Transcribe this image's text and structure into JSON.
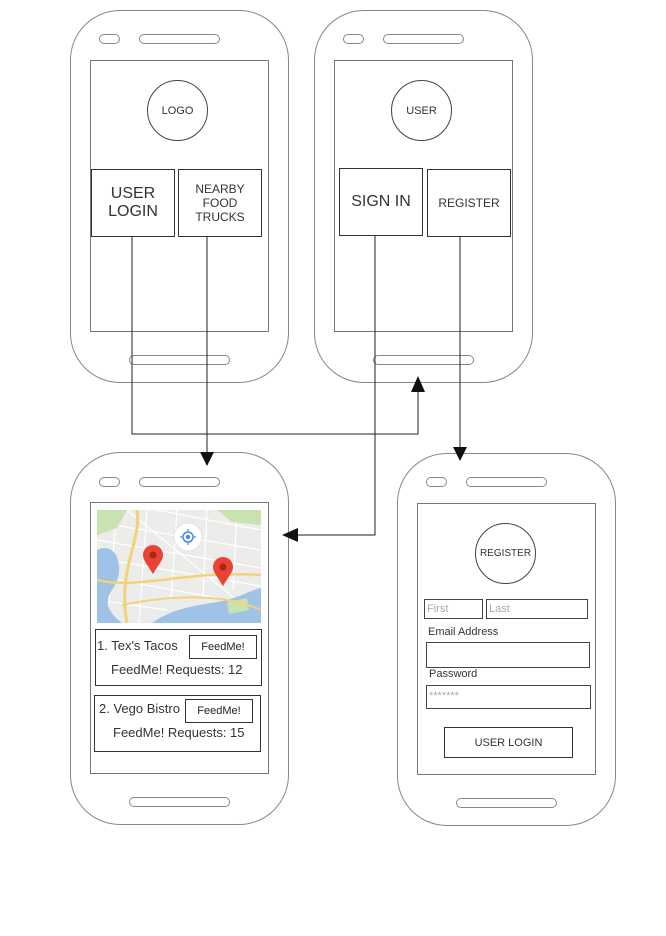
{
  "screen1": {
    "logo": "LOGO",
    "user_login_label": "USER LOGIN",
    "nearby_food_trucks_label": "NEARBY FOOD TRUCKS"
  },
  "screen2": {
    "user_avatar": "USER",
    "sign_in_label": "SIGN IN",
    "register_label": "REGISTER"
  },
  "screen3": {
    "trucks": [
      {
        "name": "1. Tex's Tacos",
        "button": "FeedMe!",
        "requests": "FeedMe! Requests: 12"
      },
      {
        "name": "2. Vego Bistro",
        "button": "FeedMe!",
        "requests": "FeedMe! Requests: 15"
      }
    ]
  },
  "screen4": {
    "header": "REGISTER",
    "first_placeholder": "First",
    "last_placeholder": "Last",
    "email_label": "Email Address",
    "password_label": "Password",
    "password_mask": "*******",
    "submit_label": "USER LOGIN"
  },
  "colors": {
    "phone_border": "#888888",
    "map_water": "#9ec3e6",
    "map_park": "#c8e2b0",
    "map_road_major": "#f3d27a",
    "pin_red": "#ea4335",
    "locate_blue": "#4285f4"
  }
}
